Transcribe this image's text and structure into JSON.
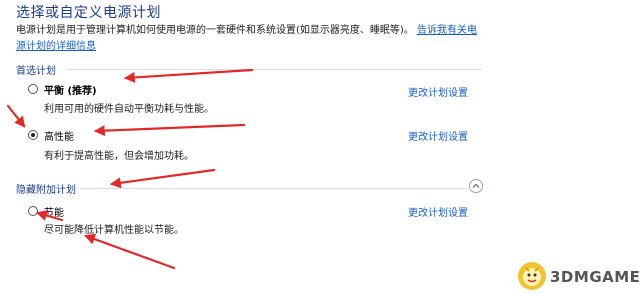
{
  "header": {
    "title": "选择或自定义电源计划",
    "description": "电源计划是用于管理计算机如何使用电源的一套硬件和系统设置(如显示器亮度、睡眠等)。",
    "description_link": "告诉我有关电源计划的详细信息"
  },
  "preferred": {
    "section_label": "首选计划",
    "plans": [
      {
        "name": "平衡 (推荐)",
        "description": "利用可用的硬件自动平衡功耗与性能。",
        "change_link": "更改计划设置",
        "selected": false
      },
      {
        "name": "高性能",
        "description": "有利于提高性能，但会增加功耗。",
        "change_link": "更改计划设置",
        "selected": true
      }
    ]
  },
  "hidden": {
    "section_label": "隐藏附加计划",
    "plans": [
      {
        "name": "节能",
        "description": "尽可能降低计算机性能以节能。",
        "change_link": "更改计划设置",
        "selected": false
      }
    ]
  },
  "watermark": {
    "text": "3DMGAME"
  },
  "colors": {
    "title": "#1a3d8f",
    "link": "#1a5fc7",
    "arrow": "#e02a2a",
    "mascot": "#f2c230"
  },
  "icons": {
    "collapse": "chevron-up-icon"
  }
}
